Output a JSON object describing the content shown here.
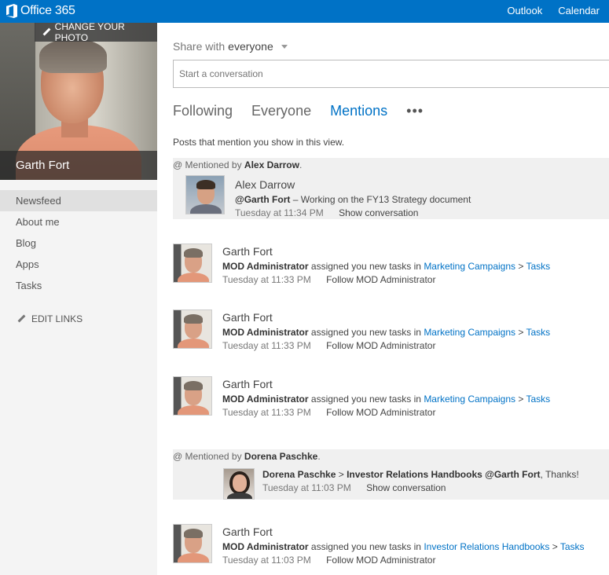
{
  "topbar": {
    "brand": "Office 365",
    "nav": [
      "Outlook",
      "Calendar"
    ]
  },
  "profile": {
    "change_photo": "CHANGE YOUR PHOTO",
    "name": "Garth Fort"
  },
  "sidebar": {
    "items": [
      "Newsfeed",
      "About me",
      "Blog",
      "Apps",
      "Tasks"
    ],
    "edit_links": "EDIT LINKS"
  },
  "share": {
    "prefix": "Share with",
    "audience": "everyone",
    "placeholder": "Start a conversation"
  },
  "tabs": [
    "Following",
    "Everyone",
    "Mentions"
  ],
  "more": "•••",
  "view_description": "Posts that mention you show in this view.",
  "mentions": [
    {
      "head_prefix": "Mentioned by",
      "by": "Alex Darrow",
      "name": "Alex Darrow",
      "mention": "@Garth Fort",
      "text": " – Working on the FY13 Strategy document",
      "time": "Tuesday at 11:34 PM",
      "action": "Show conversation"
    },
    {
      "head_prefix": "Mentioned by",
      "by": "Dorena Paschke",
      "author": "Dorena Paschke",
      "separator": ">",
      "target": "Investor Relations Handbooks",
      "mention": "@Garth Fort",
      "text": ", Thanks!",
      "time": "Tuesday at 11:03 PM",
      "action": "Show conversation"
    }
  ],
  "posts": [
    {
      "name": "Garth Fort",
      "actor": "MOD Administrator",
      "verb": " assigned you new tasks in ",
      "site": "Marketing Campaigns",
      "sep": " > ",
      "list": "Tasks",
      "time": "Tuesday at 11:33 PM",
      "action": "Follow MOD Administrator"
    },
    {
      "name": "Garth Fort",
      "actor": "MOD Administrator",
      "verb": " assigned you new tasks in ",
      "site": "Marketing Campaigns",
      "sep": " > ",
      "list": "Tasks",
      "time": "Tuesday at 11:33 PM",
      "action": "Follow MOD Administrator"
    },
    {
      "name": "Garth Fort",
      "actor": "MOD Administrator",
      "verb": " assigned you new tasks in ",
      "site": "Marketing Campaigns",
      "sep": " > ",
      "list": "Tasks",
      "time": "Tuesday at 11:33 PM",
      "action": "Follow MOD Administrator"
    },
    {
      "name": "Garth Fort",
      "actor": "MOD Administrator",
      "verb": " assigned you new tasks in ",
      "site": "Investor Relations Handbooks",
      "sep": " > ",
      "list": "Tasks",
      "time": "Tuesday at 11:03 PM",
      "action": "Follow MOD Administrator"
    }
  ],
  "colors": {
    "brand": "#0072c6",
    "mention_bg": "#f0f0f0",
    "sidebar_bg": "#f4f4f4"
  }
}
